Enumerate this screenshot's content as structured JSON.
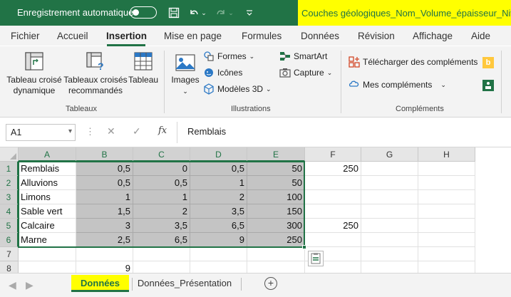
{
  "titlebar": {
    "autosave_label": "Enregistrement automatique",
    "document_title": "Couches géologiques_Nom_Volume_épaisseur_Niveau"
  },
  "ribbon_tabs": [
    "Fichier",
    "Accueil",
    "Insertion",
    "Mise en page",
    "Formules",
    "Données",
    "Révision",
    "Affichage",
    "Aide"
  ],
  "ribbon": {
    "tableaux": {
      "label": "Tableaux",
      "pivot_table": [
        "Tableau croisé",
        "dynamique"
      ],
      "recommended_pivot": [
        "Tableaux croisés",
        "recommandés"
      ],
      "table": "Tableau"
    },
    "illustrations": {
      "label": "Illustrations",
      "images": "Images",
      "shapes": "Formes",
      "icons": "Icônes",
      "models3d": "Modèles 3D",
      "smartart": "SmartArt",
      "screenshot": "Capture"
    },
    "complements": {
      "label": "Compléments",
      "get_addins": "Télécharger des compléments",
      "my_addins": "Mes compléments"
    }
  },
  "formula_bar": {
    "name_box": "A1",
    "fx": "fx",
    "content": "Remblais"
  },
  "columns": [
    "A",
    "B",
    "C",
    "D",
    "E",
    "F",
    "G",
    "H"
  ],
  "rows": [
    {
      "num": "1",
      "cells": [
        "Remblais",
        "0,5",
        "0",
        "0,5",
        "50",
        "250",
        "",
        ""
      ]
    },
    {
      "num": "2",
      "cells": [
        "Alluvions",
        "0,5",
        "0,5",
        "1",
        "50",
        "",
        "",
        ""
      ]
    },
    {
      "num": "3",
      "cells": [
        "Limons",
        "1",
        "1",
        "2",
        "100",
        "",
        "",
        ""
      ]
    },
    {
      "num": "4",
      "cells": [
        "Sable vert",
        "1,5",
        "2",
        "3,5",
        "150",
        "",
        "",
        ""
      ]
    },
    {
      "num": "5",
      "cells": [
        "Calcaire",
        "3",
        "3,5",
        "6,5",
        "300",
        "250",
        "",
        ""
      ]
    },
    {
      "num": "6",
      "cells": [
        "Marne",
        "2,5",
        "6,5",
        "9",
        "250",
        "",
        "",
        ""
      ]
    },
    {
      "num": "7",
      "cells": [
        "",
        "",
        "",
        "",
        "",
        "",
        "",
        ""
      ]
    },
    {
      "num": "8",
      "cells": [
        "",
        "9",
        "",
        "",
        "",
        "",
        "",
        ""
      ]
    }
  ],
  "sheets": [
    "Données",
    "Données_Présentation"
  ],
  "colors": {
    "excel_green": "#217346",
    "highlight_yellow": "#ffff00",
    "shaded_cell": "#c4c4c4"
  }
}
